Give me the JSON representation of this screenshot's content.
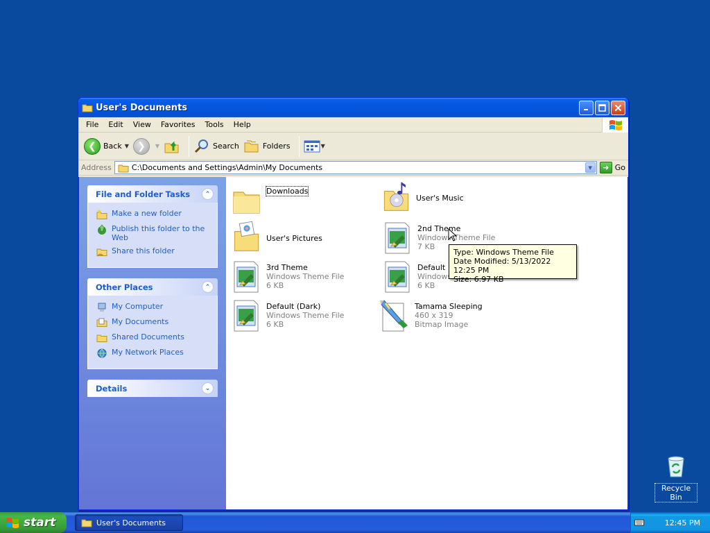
{
  "window": {
    "title": "User's Documents",
    "menu": [
      "File",
      "Edit",
      "View",
      "Favorites",
      "Tools",
      "Help"
    ],
    "toolbar": {
      "back_label": "Back",
      "search_label": "Search",
      "folders_label": "Folders"
    },
    "address": {
      "label": "Address",
      "value": "C:\\Documents and Settings\\Admin\\My Documents",
      "go_label": "Go"
    }
  },
  "sidebar": {
    "file_tasks": {
      "title": "File and Folder Tasks",
      "items": [
        "Make a new folder",
        "Publish this folder to the Web",
        "Share this folder"
      ]
    },
    "other_places": {
      "title": "Other Places",
      "items": [
        "My Computer",
        "My Documents",
        "Shared Documents",
        "My Network Places"
      ]
    },
    "details": {
      "title": "Details"
    }
  },
  "files": [
    {
      "name": "Downloads",
      "line2": "",
      "line3": "",
      "icon": "folder-icon"
    },
    {
      "name": "User's Music",
      "line2": "",
      "line3": "",
      "icon": "music-folder-icon"
    },
    {
      "name": "User's Pictures",
      "line2": "",
      "line3": "",
      "icon": "pictures-folder-icon"
    },
    {
      "name": "2nd Theme",
      "line2": "Windows Theme File",
      "line3": "7 KB",
      "icon": "theme-file-icon"
    },
    {
      "name": "3rd Theme",
      "line2": "Windows Theme File",
      "line3": "6 KB",
      "icon": "theme-file-icon"
    },
    {
      "name": "Default",
      "line2": "Windows",
      "line3": "6 KB",
      "icon": "theme-file-icon"
    },
    {
      "name": "Default (Dark)",
      "line2": "Windows Theme File",
      "line3": "6 KB",
      "icon": "theme-file-icon"
    },
    {
      "name": "Tamama Sleeping",
      "line2": "460 x 319",
      "line3": "Bitmap Image",
      "icon": "bitmap-image-icon"
    }
  ],
  "tooltip": {
    "type": "Type: Windows Theme File",
    "modified": "Date Modified: 5/13/2022 12:25 PM",
    "size": "Size: 6.97 KB"
  },
  "desktop": {
    "recycle_bin_label": "Recycle Bin"
  },
  "taskbar": {
    "start_label": "start",
    "task_label": "User's Documents",
    "clock": "12:45 PM"
  }
}
